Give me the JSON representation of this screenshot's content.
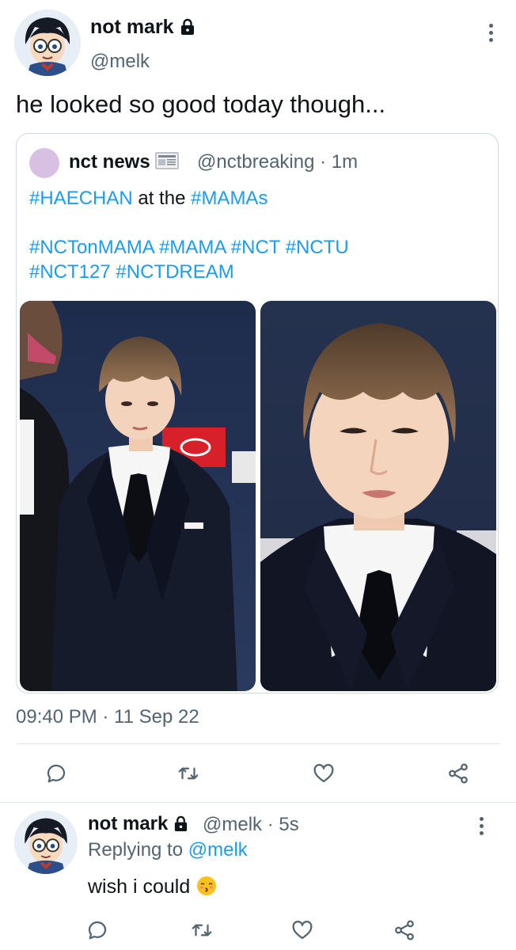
{
  "main_tweet": {
    "display_name": "not mark",
    "handle": "@melk",
    "text": "he looked so good today though...",
    "timestamp": "09:40 PM · 11 Sep 22"
  },
  "quoted_tweet": {
    "display_name": "nct news",
    "handle_time": "@nctbreaking · 1m",
    "avatar_color": "#d7c0e2",
    "line1": {
      "hashtag1": "#HAECHAN",
      "middle": " at the ",
      "hashtag2": "#MAMAs"
    },
    "hashtags_row1": [
      "#NCTonMAMA",
      "#MAMA",
      "#NCT",
      "#NCTU"
    ],
    "hashtags_row2": [
      "#NCT127",
      "#NCTDREAM"
    ],
    "photos": [
      "full-body-photo",
      "close-up-photo"
    ]
  },
  "actions": [
    "reply-icon",
    "retweet-icon",
    "like-icon",
    "share-icon"
  ],
  "reply": {
    "display_name": "not mark",
    "meta": "@melk · 5s",
    "replying_prefix": "Replying to ",
    "replying_handle": "@melk",
    "text": "wish i could",
    "emoji": "kissing-face-emoji"
  },
  "colors": {
    "link": "#1d9bf0",
    "secondary": "#536471",
    "border": "#cfd9de"
  }
}
